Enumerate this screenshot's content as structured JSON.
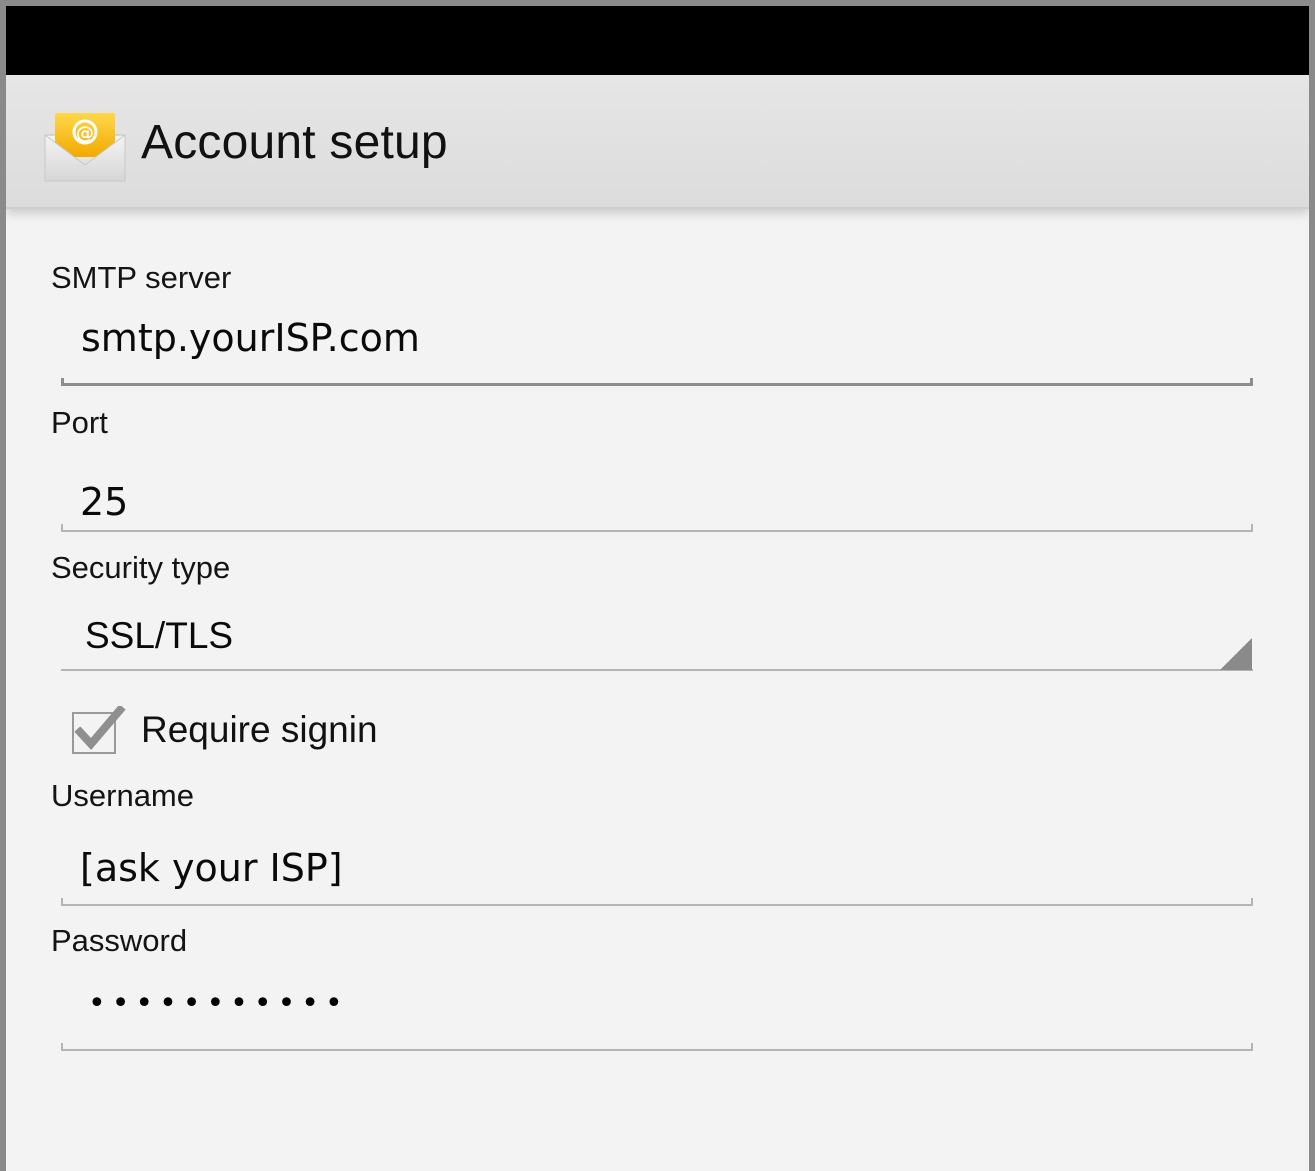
{
  "header": {
    "title": "Account setup",
    "icon": "email-app-icon"
  },
  "form": {
    "smtp_server": {
      "label": "SMTP server",
      "value": "smtp.yourISP.com"
    },
    "port": {
      "label": "Port",
      "value": "25"
    },
    "security_type": {
      "label": "Security type",
      "value": "SSL/TLS"
    },
    "require_signin": {
      "label": "Require signin",
      "checked": true
    },
    "username": {
      "label": "Username",
      "value": "[ask your ISP]"
    },
    "password": {
      "label": "Password",
      "value": "•••••••••••"
    }
  },
  "colors": {
    "status_bar": "#000000",
    "action_bar": "#e0e0e0",
    "background": "#f3f3f3",
    "icon_envelope": "#f2b705"
  }
}
